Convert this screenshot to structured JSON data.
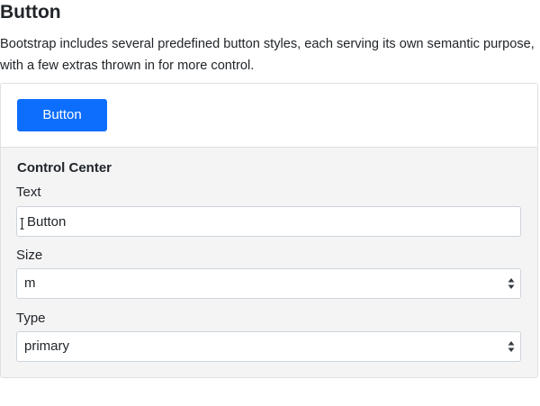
{
  "header": {
    "title": "Button",
    "description": "Bootstrap includes several predefined button styles, each serving its own semantic purpose, with a few extras thrown in for more control."
  },
  "preview": {
    "button_label": "Button",
    "button_color": "#0d6efd"
  },
  "control_center": {
    "title": "Control Center",
    "text_field": {
      "label": "Text",
      "value": "Button"
    },
    "size_field": {
      "label": "Size",
      "selected": "m"
    },
    "type_field": {
      "label": "Type",
      "selected": "primary"
    }
  },
  "icons": {
    "select_arrows": "chevron-up-down-icon",
    "cursor": "text-cursor-icon"
  }
}
